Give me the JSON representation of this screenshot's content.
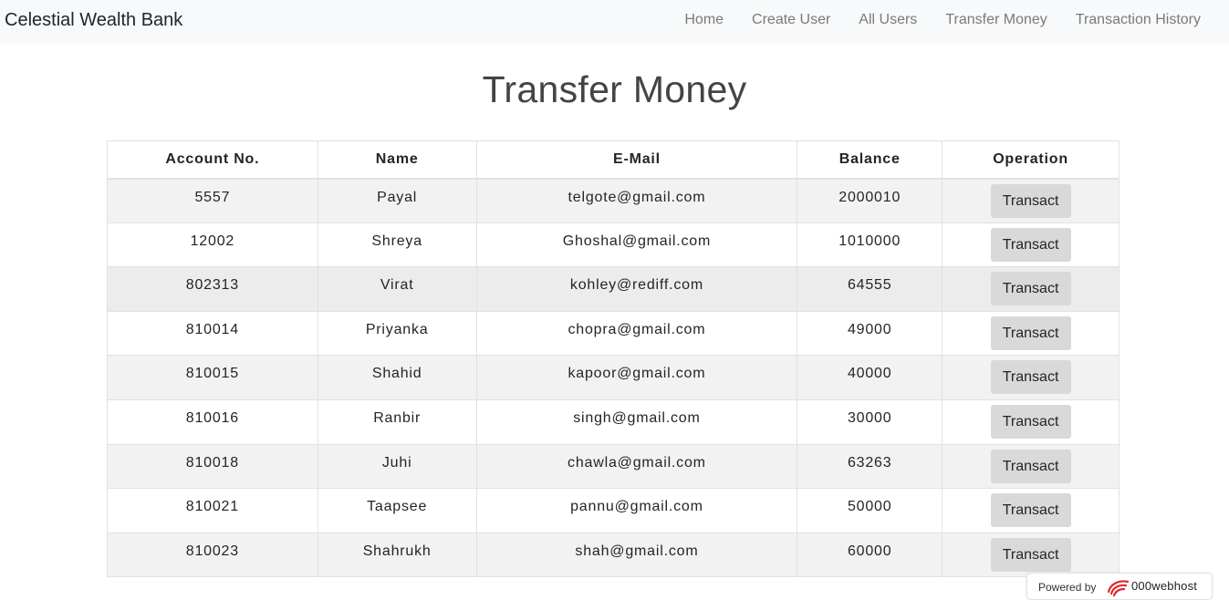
{
  "app": {
    "brand": "Celestial Wealth Bank"
  },
  "nav": {
    "items": [
      {
        "label": "Home"
      },
      {
        "label": "Create User"
      },
      {
        "label": "All Users"
      },
      {
        "label": "Transfer Money"
      },
      {
        "label": "Transaction History"
      }
    ]
  },
  "page": {
    "title": "Transfer Money"
  },
  "table": {
    "headers": [
      "Account No.",
      "Name",
      "E-Mail",
      "Balance",
      "Operation"
    ],
    "action_label": "Transact",
    "rows": [
      {
        "account": "5557",
        "name": "Payal",
        "email": "telgote@gmail.com",
        "balance": "2000010"
      },
      {
        "account": "12002",
        "name": "Shreya",
        "email": "Ghoshal@gmail.com",
        "balance": "1010000"
      },
      {
        "account": "802313",
        "name": "Virat",
        "email": "kohley@rediff.com",
        "balance": "64555"
      },
      {
        "account": "810014",
        "name": "Priyanka",
        "email": "chopra@gmail.com",
        "balance": "49000"
      },
      {
        "account": "810015",
        "name": "Shahid",
        "email": "kapoor@gmail.com",
        "balance": "40000"
      },
      {
        "account": "810016",
        "name": "Ranbir",
        "email": "singh@gmail.com",
        "balance": "30000"
      },
      {
        "account": "810018",
        "name": "Juhi",
        "email": "chawla@gmail.com",
        "balance": "63263"
      },
      {
        "account": "810021",
        "name": "Taapsee",
        "email": "pannu@gmail.com",
        "balance": "50000"
      },
      {
        "account": "810023",
        "name": "Shahrukh",
        "email": "shah@gmail.com",
        "balance": "60000"
      }
    ]
  },
  "footer_badge": {
    "powered_by": "Powered by",
    "host_name": "000webhost",
    "logo_icon": "000webhost-logo-icon"
  },
  "colors": {
    "navbar_bg": "#f8f9fa",
    "button_bg": "#d9d9d9",
    "stripe_bg": "#f2f2f2",
    "logo_red": "#e0262f"
  }
}
